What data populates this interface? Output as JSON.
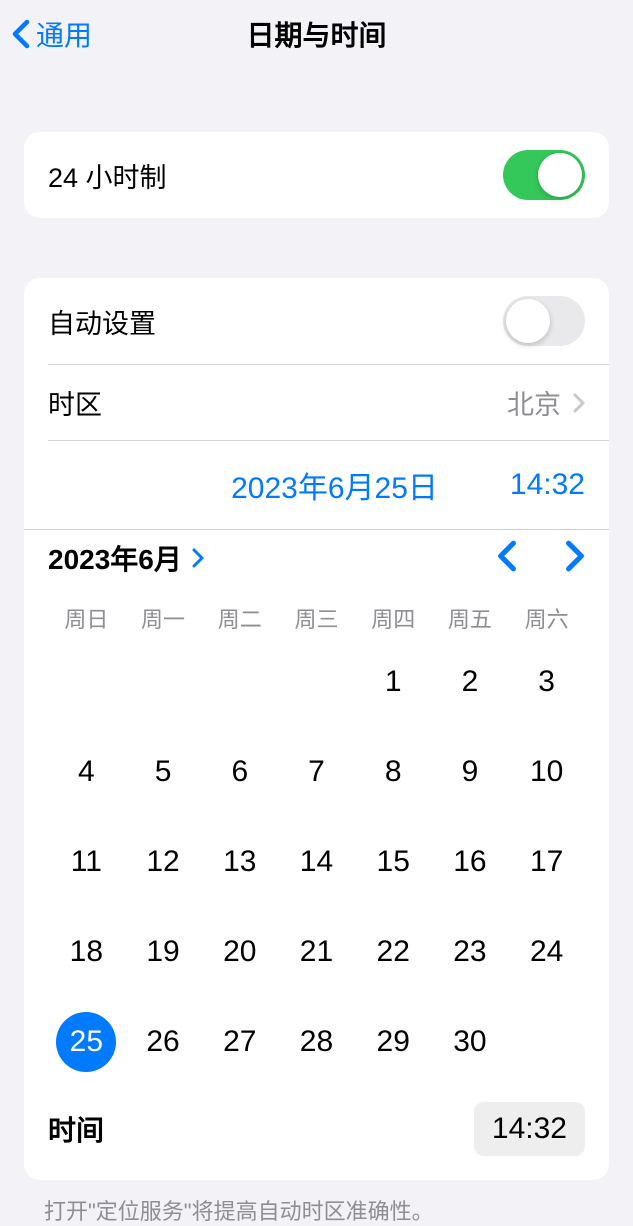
{
  "header": {
    "back_label": "通用",
    "title": "日期与时间"
  },
  "section1": {
    "hour24_label": "24 小时制",
    "hour24_enabled": true
  },
  "section2": {
    "auto_set_label": "自动设置",
    "auto_set_enabled": false,
    "timezone_label": "时区",
    "timezone_value": "北京",
    "date_value": "2023年6月25日",
    "time_value": "14:32",
    "calendar": {
      "month_label": "2023年6月",
      "weekdays": [
        "周日",
        "周一",
        "周二",
        "周三",
        "周四",
        "周五",
        "周六"
      ],
      "start_day_index": 4,
      "days_in_month": 30,
      "selected_day": 25
    },
    "time_row_label": "时间",
    "time_picker_value": "14:32"
  },
  "footer": "打开\"定位服务\"将提高自动时区准确性。"
}
